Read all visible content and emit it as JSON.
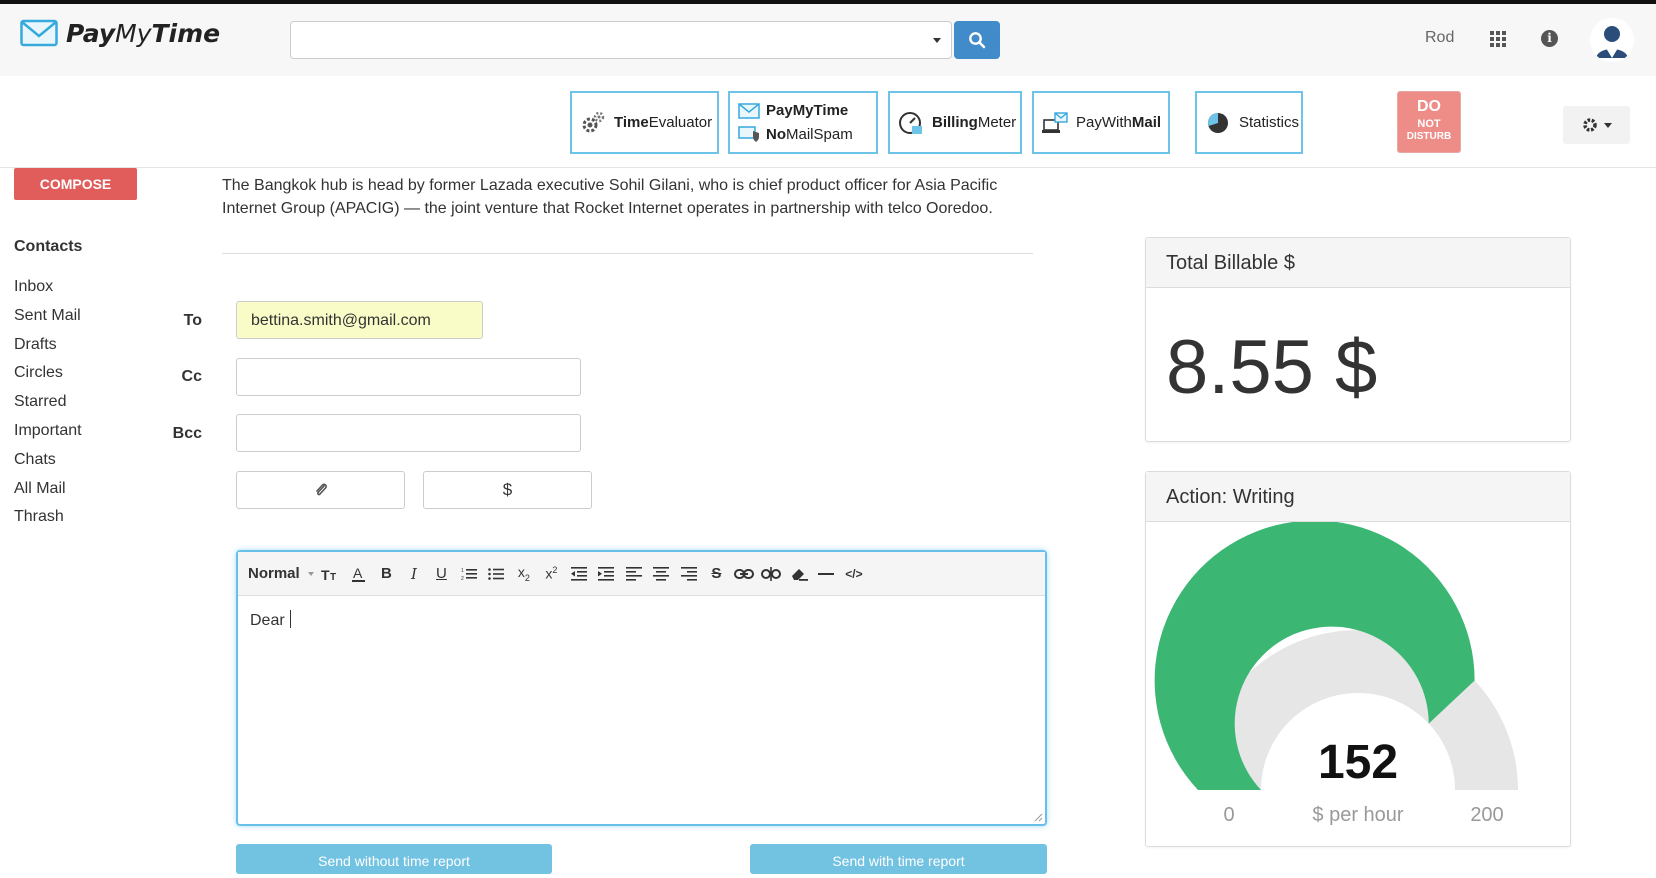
{
  "app": {
    "logo_main": "Pay",
    "logo_light": "My",
    "logo_end": "Time"
  },
  "search": {
    "value": "",
    "placeholder": ""
  },
  "user": {
    "name": "Rod"
  },
  "apps": [
    {
      "bold": "Time",
      "light": "Evaluator"
    },
    {
      "bold": "PayMyTime"
    },
    {
      "bold": "No",
      "light": "MailSpam"
    },
    {
      "bold": "Billing",
      "light": "Meter"
    },
    {
      "light": "PayWith",
      "bold": "Mail"
    },
    {
      "light": "Statistics"
    }
  ],
  "dnd": {
    "line1": "DO",
    "line2": "NOT",
    "line3": "DISTURB"
  },
  "sidebar": {
    "compose_label": "COMPOSE",
    "contacts_title": "Contacts",
    "items": [
      "Inbox",
      "Sent Mail",
      "Drafts",
      "Circles",
      "Starred",
      "Important",
      "Chats",
      "All Mail",
      "Thrash"
    ]
  },
  "article": {
    "text": "The Bangkok hub is head by former Lazada executive Sohil Gilani, who is chief product officer for Asia Pacific Internet Group (APACIG) — the joint venture that Rocket Internet operates in partnership with telco Ooredoo."
  },
  "compose": {
    "to_label": "To",
    "cc_label": "Cc",
    "bcc_label": "Bcc",
    "to_value": "bettina.smith@gmail.com",
    "cc_value": "",
    "bcc_value": "",
    "dollar_label": "$",
    "format_label": "Normal",
    "body_text": "Dear ",
    "send_without_label": "Send without time report",
    "send_with_label": "Send with time report"
  },
  "billable": {
    "title": "Total Billable $",
    "value": "8.55 $"
  },
  "action": {
    "title": "Action: Writing",
    "gauge_value": "152",
    "gauge_min": "0",
    "gauge_max": "200",
    "gauge_unit": "$ per hour",
    "gauge_fraction": 0.76,
    "colors": {
      "fill": "#3bb773",
      "track": "#e6e6e6"
    }
  }
}
